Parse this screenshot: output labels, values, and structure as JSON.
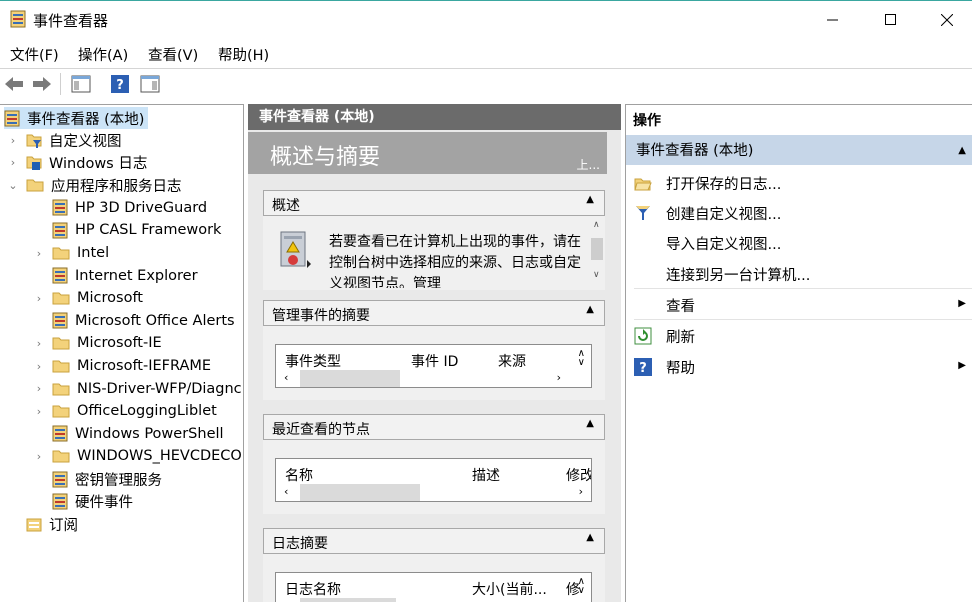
{
  "window": {
    "title": "事件查看器"
  },
  "menu": [
    "文件(F)",
    "操作(A)",
    "查看(V)",
    "帮助(H)"
  ],
  "tree": {
    "root": "事件查看器 (本地)",
    "items": [
      {
        "label": "自定义视图",
        "level": 1,
        "expandable": true,
        "icon": "custom-view-icon"
      },
      {
        "label": "Windows 日志",
        "level": 1,
        "expandable": true,
        "icon": "windows-logs-icon"
      },
      {
        "label": "应用程序和服务日志",
        "level": 1,
        "expandable": true,
        "expanded": true,
        "icon": "folder-open-icon"
      },
      {
        "label": "HP 3D DriveGuard",
        "level": 2,
        "icon": "log-icon"
      },
      {
        "label": "HP CASL Framework",
        "level": 2,
        "icon": "log-icon"
      },
      {
        "label": "Intel",
        "level": 2,
        "expandable": true,
        "icon": "folder-icon"
      },
      {
        "label": "Internet Explorer",
        "level": 2,
        "icon": "log-icon"
      },
      {
        "label": "Microsoft",
        "level": 2,
        "expandable": true,
        "icon": "folder-icon"
      },
      {
        "label": "Microsoft Office Alerts",
        "level": 2,
        "icon": "log-icon"
      },
      {
        "label": "Microsoft-IE",
        "level": 2,
        "expandable": true,
        "icon": "folder-icon"
      },
      {
        "label": "Microsoft-IEFRAME",
        "level": 2,
        "expandable": true,
        "icon": "folder-icon"
      },
      {
        "label": "NIS-Driver-WFP/Diagnc",
        "level": 2,
        "expandable": true,
        "icon": "folder-icon"
      },
      {
        "label": "OfficeLoggingLiblet",
        "level": 2,
        "expandable": true,
        "icon": "folder-icon"
      },
      {
        "label": "Windows PowerShell",
        "level": 2,
        "icon": "log-icon"
      },
      {
        "label": "WINDOWS_HEVCDECO",
        "level": 2,
        "expandable": true,
        "icon": "folder-icon"
      },
      {
        "label": "密钥管理服务",
        "level": 2,
        "icon": "log-icon"
      },
      {
        "label": "硬件事件",
        "level": 2,
        "icon": "log-icon"
      },
      {
        "label": "订阅",
        "level": 1,
        "icon": "subscription-icon"
      }
    ]
  },
  "middle": {
    "header": "事件查看器 (本地)",
    "banner_title": "概述与摘要",
    "banner_more": "上...",
    "overview": {
      "title": "概述",
      "text": "若要查看已在计算机上出现的事件，请在控制台树中选择相应的来源、日志或自定义视图节点。管理"
    },
    "admin_summary": {
      "title": "管理事件的摘要",
      "columns": [
        "事件类型",
        "事件 ID",
        "来源"
      ]
    },
    "recent_nodes": {
      "title": "最近查看的节点",
      "columns": [
        "名称",
        "描述",
        "修改"
      ]
    },
    "log_summary": {
      "title": "日志摘要",
      "columns": [
        "日志名称",
        "大小(当前...",
        "修"
      ]
    }
  },
  "actions": {
    "header": "操作",
    "group": "事件查看器 (本地)",
    "items": [
      {
        "label": "打开保存的日志...",
        "icon": "open-folder-icon"
      },
      {
        "label": "创建自定义视图...",
        "icon": "filter-icon"
      },
      {
        "label": "导入自定义视图...",
        "icon": ""
      },
      {
        "label": "连接到另一台计算机...",
        "icon": ""
      },
      {
        "label": "查看",
        "icon": "",
        "submenu": true
      },
      {
        "label": "刷新",
        "icon": "refresh-icon"
      },
      {
        "label": "帮助",
        "icon": "help-icon",
        "submenu": true
      }
    ]
  }
}
